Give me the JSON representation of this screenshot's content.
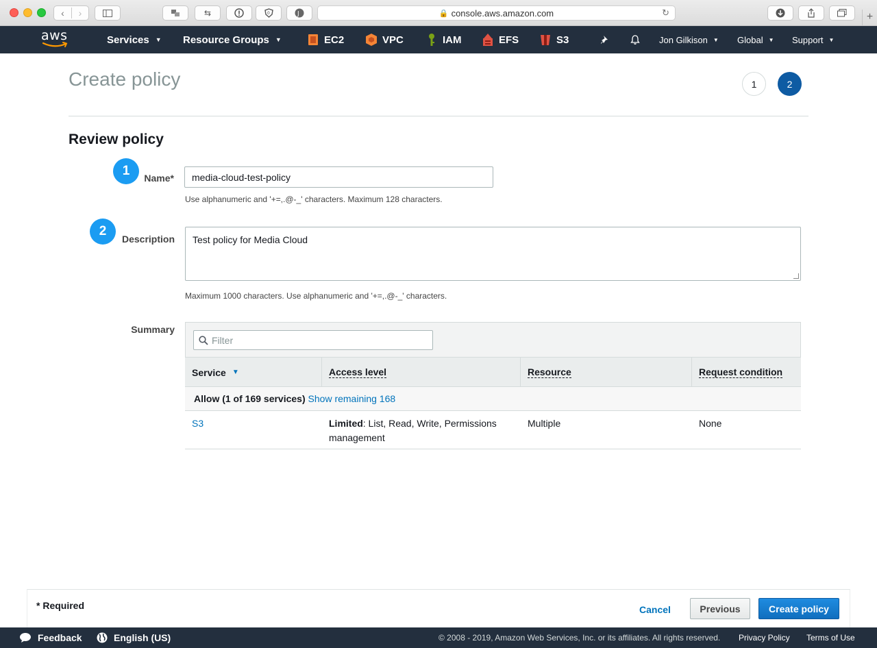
{
  "browser": {
    "url": "console.aws.amazon.com",
    "new_tab_label": "+"
  },
  "nav": {
    "logo_text": "aws",
    "services": "Services",
    "resource_groups": "Resource Groups",
    "shortcuts": [
      {
        "label": "EC2",
        "color": "#f58536"
      },
      {
        "label": "VPC",
        "color": "#f58536"
      },
      {
        "label": "IAM",
        "color": "#7aa116"
      },
      {
        "label": "EFS",
        "color": "#e05243"
      },
      {
        "label": "S3",
        "color": "#e05243"
      }
    ],
    "user": "Jon Gilkison",
    "region": "Global",
    "support": "Support"
  },
  "page": {
    "title": "Create policy",
    "steps": [
      "1",
      "2"
    ],
    "section_title": "Review policy"
  },
  "form": {
    "name": {
      "badge": "1",
      "label": "Name*",
      "value": "media-cloud-test-policy",
      "hint": "Use alphanumeric and '+=,.@-_' characters. Maximum 128 characters."
    },
    "description": {
      "badge": "2",
      "label": "Description",
      "value": "Test policy for Media Cloud",
      "hint": "Maximum 1000 characters. Use alphanumeric and '+=,.@-_' characters."
    },
    "summary_label": "Summary"
  },
  "summary": {
    "filter_placeholder": "Filter",
    "columns": [
      "Service",
      "Access level",
      "Resource",
      "Request condition"
    ],
    "group_label": "Allow (1 of 169 services)",
    "group_link": "Show remaining 168",
    "rows": [
      {
        "service": "S3",
        "access_level_bold": "Limited",
        "access_level_rest": ": List, Read, Write, Permissions management",
        "resource": "Multiple",
        "condition": "None"
      }
    ]
  },
  "footer": {
    "required": "* Required",
    "cancel": "Cancel",
    "previous": "Previous",
    "create": "Create policy"
  },
  "console_footer": {
    "feedback": "Feedback",
    "language": "English (US)",
    "copyright": "© 2008 - 2019, Amazon Web Services, Inc. or its affiliates. All rights reserved.",
    "privacy": "Privacy Policy",
    "terms": "Terms of Use"
  }
}
